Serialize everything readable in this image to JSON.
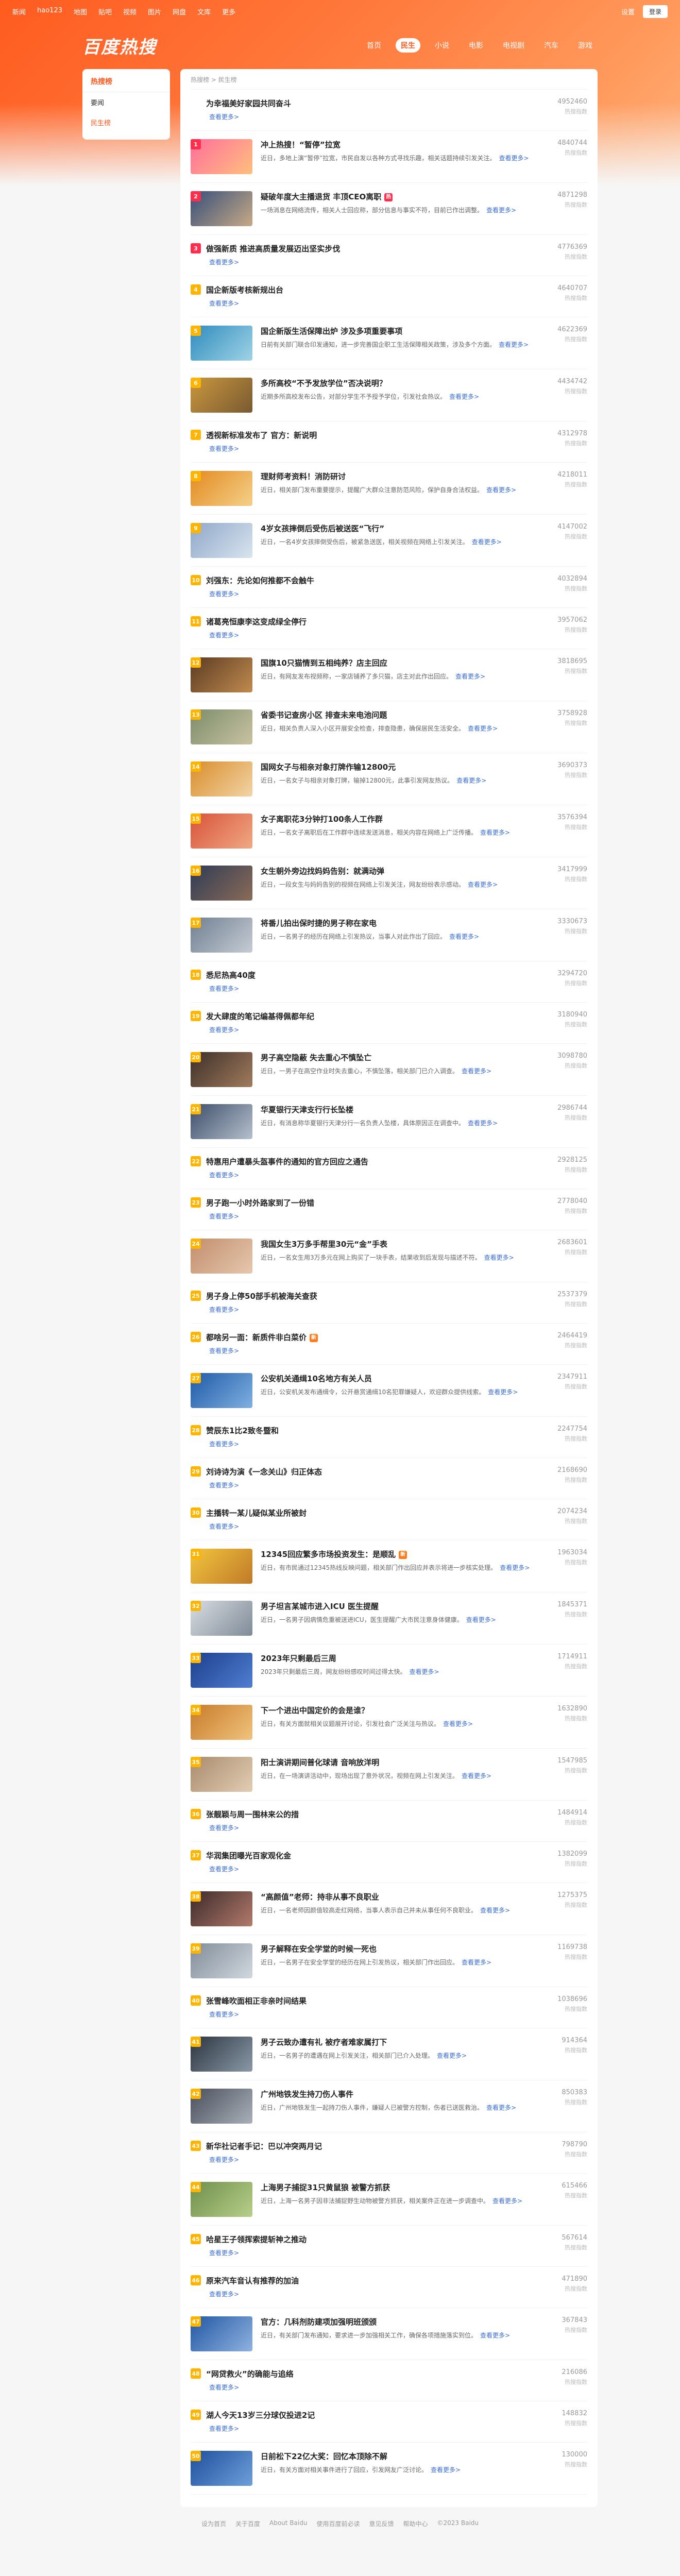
{
  "topnav": {
    "links": [
      "新闻",
      "hao123",
      "地图",
      "贴吧",
      "视频",
      "图片",
      "网盘",
      "文库",
      "更多"
    ],
    "settings": "设置",
    "login": "登录"
  },
  "header": {
    "logo": "百度热搜",
    "tabs": [
      "首页",
      "民生",
      "小说",
      "电影",
      "电视剧",
      "汽车",
      "游戏"
    ],
    "active_tab": "民生"
  },
  "sidebar": {
    "title": "热搜榜",
    "items": [
      "要闻",
      "民生榜"
    ]
  },
  "main": {
    "breadcrumb": "热搜榜 > 民生榜",
    "more_label": "查看更多>",
    "score_label": "热搜指数",
    "items": [
      {
        "rank": "",
        "title": "为幸福美好家园共同奋斗",
        "img": false,
        "badge": "",
        "desc": "",
        "score": "4952460",
        "colors": []
      },
      {
        "rank": "1",
        "title": "冲上热搜！“暂停”拉宽",
        "img": true,
        "badge": "",
        "desc": "近日，多地上演“暂停”拉宽，市民自发以各种方式寻找乐趣，相关话题持续引发关注。",
        "score": "4840744",
        "colors": [
          "#ff6e9c",
          "#ffbf7e"
        ]
      },
      {
        "rank": "2",
        "title": "疑破年度大主播退货 丰顶CEO离职",
        "img": true,
        "badge": "hot",
        "desc": "一场消息在网络流传，相关人士回应称，部分信息与事实不符，目前已作出调整。",
        "score": "4871298",
        "colors": [
          "#374f7a",
          "#c7a987"
        ]
      },
      {
        "rank": "3",
        "title": "做强新质 推进高质量发展迈出坚实步伐",
        "img": false,
        "badge": "",
        "desc": "",
        "score": "4776369",
        "colors": []
      },
      {
        "rank": "4",
        "title": "国企新版考核新规出台",
        "img": false,
        "badge": "",
        "desc": "",
        "score": "4640707",
        "colors": []
      },
      {
        "rank": "5",
        "title": "国企新版生活保障出炉 涉及多项重要事项",
        "img": true,
        "badge": "",
        "desc": "日前有关部门联合印发通知，进一步完善国企职工生活保障相关政策，涉及多个方面。",
        "score": "4622369",
        "colors": [
          "#2e8cbe",
          "#9fd3e6"
        ]
      },
      {
        "rank": "6",
        "title": "多所高校“不予发放学位”否决说明？",
        "img": true,
        "badge": "",
        "desc": "近期多所高校发布公告，对部分学生不予授予学位，引发社会热议。",
        "score": "4434742",
        "colors": [
          "#c9973c",
          "#7a5a33"
        ]
      },
      {
        "rank": "7",
        "title": "透视新标准发布了 官方：新说明",
        "img": false,
        "badge": "",
        "desc": "",
        "score": "4312978",
        "colors": []
      },
      {
        "rank": "8",
        "title": "理财师考资料！消防研讨",
        "img": true,
        "badge": "",
        "desc": "近日，相关部门发布重要提示，提醒广大群众注意防范风险，保护自身合法权益。",
        "score": "4218011",
        "colors": [
          "#e38a1f",
          "#f5d08a"
        ]
      },
      {
        "rank": "9",
        "title": "4岁女孩摔倒后受伤后被送医“飞行”",
        "img": true,
        "badge": "",
        "desc": "近日，一名4岁女孩摔倒受伤后，被紧急送医，相关视频在网络上引发关注。",
        "score": "4147002",
        "colors": [
          "#8fa7c8",
          "#d9e4ef"
        ]
      },
      {
        "rank": "10",
        "title": "刘强东：先论如何推都不会触牛",
        "img": false,
        "badge": "",
        "desc": "",
        "score": "4032894",
        "colors": []
      },
      {
        "rank": "11",
        "title": "诸葛亮恒康李这变成绿全停行",
        "img": false,
        "badge": "",
        "desc": "",
        "score": "3957062",
        "colors": []
      },
      {
        "rank": "12",
        "title": "国旗10只猫情到五相纯养？店主回应",
        "img": true,
        "badge": "",
        "desc": "近日，有网友发布视频称，一家店铺养了多只猫，店主对此作出回应。",
        "score": "3818695",
        "colors": [
          "#5a3b22",
          "#c18b4f"
        ]
      },
      {
        "rank": "13",
        "title": "省委书记查房小区 排查未来电池问题",
        "img": true,
        "badge": "",
        "desc": "近日，相关负责人深入小区开展安全检查，排查隐患，确保居民生活安全。",
        "score": "3758928",
        "colors": [
          "#7c8d6a",
          "#c9c2a2"
        ]
      },
      {
        "rank": "14",
        "title": "国网女子与相亲对象打牌作输12800元",
        "img": true,
        "badge": "",
        "desc": "近日，一名女子与相亲对象打牌，输掉12800元，此事引发网友热议。",
        "score": "3690373",
        "colors": [
          "#d98d2b",
          "#f2d4a6"
        ]
      },
      {
        "rank": "15",
        "title": "女子离职花3分钟打100条人工作群",
        "img": true,
        "badge": "",
        "desc": "近日，一名女子离职后在工作群中连续发送消息，相关内容在网络上广泛传播。",
        "score": "3576394",
        "colors": [
          "#d8523a",
          "#f0a983"
        ]
      },
      {
        "rank": "16",
        "title": "女生朝外旁边找妈妈告别：就满动弹",
        "img": true,
        "badge": "",
        "desc": "近日，一段女生与妈妈告别的视频在网络上引发关注，网友纷纷表示感动。",
        "score": "3417999",
        "colors": [
          "#2f3b55",
          "#8a6b58"
        ]
      },
      {
        "rank": "17",
        "title": "将番儿拍出保时捷的男子称在家电",
        "img": true,
        "badge": "",
        "desc": "近日，一名男子的经历在网络上引发热议，当事人对此作出了回应。",
        "score": "3330673",
        "colors": [
          "#6f7f91",
          "#c6ccd4"
        ]
      },
      {
        "rank": "18",
        "title": "悉尼热高40度",
        "img": false,
        "badge": "",
        "desc": "",
        "score": "3294720",
        "colors": []
      },
      {
        "rank": "19",
        "title": "发大肆度的笔记编基得佩都年纪",
        "img": false,
        "badge": "",
        "desc": "",
        "score": "3180940",
        "colors": []
      },
      {
        "rank": "20",
        "title": "男子高空隐蔽 失去重心不慎坠亡",
        "img": true,
        "badge": "",
        "desc": "近日，一男子在高空作业时失去重心，不慎坠落，相关部门已介入调查。",
        "score": "3098780",
        "colors": [
          "#3c2f29",
          "#a17b5d"
        ]
      },
      {
        "rank": "21",
        "title": "华夏银行天津支行行长坠楼",
        "img": true,
        "badge": "",
        "desc": "近日，有消息称华夏银行天津分行一名负责人坠楼，具体原因正在调查中。",
        "score": "2986744",
        "colors": [
          "#3d4e6b",
          "#b5bfcc"
        ]
      },
      {
        "rank": "22",
        "title": "特惠用户遭暴头盔事件的通知的官方回应之通告",
        "img": false,
        "badge": "",
        "desc": "",
        "score": "2928125",
        "colors": []
      },
      {
        "rank": "23",
        "title": "男子跑一小时外路家到了一份错",
        "img": false,
        "badge": "",
        "desc": "",
        "score": "2778040",
        "colors": []
      },
      {
        "rank": "24",
        "title": "我国女生3万多手帮里30元“金”手表",
        "img": true,
        "badge": "",
        "desc": "近日，一名女生用3万多元在网上购买了一块手表，结果收到后发现与描述不符。",
        "score": "2683601",
        "colors": [
          "#c28e6c",
          "#e6c7ae"
        ]
      },
      {
        "rank": "25",
        "title": "男子身上停50部手机被海关查获",
        "img": false,
        "badge": "",
        "desc": "",
        "score": "2537379",
        "colors": []
      },
      {
        "rank": "26",
        "title": "都啥另一面：新质件非白菜价",
        "img": false,
        "badge": "new",
        "desc": "",
        "score": "2464419",
        "colors": []
      },
      {
        "rank": "27",
        "title": "公安机关通缉10名地方有关人员",
        "img": true,
        "badge": "",
        "desc": "近日，公安机关发布通缉令，公开悬赏通缉10名犯罪嫌疑人，欢迎群众提供线索。",
        "score": "2347911",
        "colors": [
          "#1f5aa8",
          "#7fb0e0"
        ]
      },
      {
        "rank": "28",
        "title": "赞辰东1比2致冬暨和",
        "img": false,
        "badge": "",
        "desc": "",
        "score": "2247754",
        "colors": []
      },
      {
        "rank": "29",
        "title": "刘诗诗为演《一念关山》归正体态",
        "img": false,
        "badge": "",
        "desc": "",
        "score": "2168690",
        "colors": []
      },
      {
        "rank": "30",
        "title": "主播转一某儿疑似某业所被封",
        "img": false,
        "badge": "",
        "desc": "",
        "score": "2074234",
        "colors": []
      },
      {
        "rank": "31",
        "title": "12345回应繁多市场投资发生：是顺乱",
        "img": true,
        "badge": "new",
        "desc": "近日，有市民通过12345热线反映问题，相关部门作出回应并表示将进一步核实处理。",
        "score": "1963034",
        "colors": [
          "#f2c53d",
          "#c07a28"
        ]
      },
      {
        "rank": "32",
        "title": "男子坦言某城市进入ICU 医生提醒",
        "img": true,
        "badge": "",
        "desc": "近日，一名男子因病情危重被送进ICU，医生提醒广大市民注意身体健康。",
        "score": "1845371",
        "colors": [
          "#d9dde2",
          "#7f8b98"
        ]
      },
      {
        "rank": "33",
        "title": "2023年只剩最后三周",
        "img": true,
        "badge": "",
        "desc": "2023年只剩最后三周，网友纷纷感叹时间过得太快。",
        "score": "1714911",
        "colors": [
          "#1d3f8c",
          "#4f7ed1"
        ]
      },
      {
        "rank": "34",
        "title": "下一个进出中国定价的会是谁？",
        "img": true,
        "badge": "",
        "desc": "近日，有关方面就相关议题展开讨论，引发社会广泛关注与热议。",
        "score": "1632890",
        "colors": [
          "#c87b2a",
          "#f0c37d"
        ]
      },
      {
        "rank": "35",
        "title": "阳士演讲期间普化球请 音响放洋明",
        "img": true,
        "badge": "",
        "desc": "近日，在一场演讲活动中，现场出现了意外状况，视频在网上引发关注。",
        "score": "1547985",
        "colors": [
          "#a98b6d",
          "#e2cdb4"
        ]
      },
      {
        "rank": "36",
        "title": "张靓颖与周一围林来公的措",
        "img": false,
        "badge": "",
        "desc": "",
        "score": "1484914",
        "colors": []
      },
      {
        "rank": "37",
        "title": "华润集团曝光百家观化金",
        "img": false,
        "badge": "",
        "desc": "",
        "score": "1382099",
        "colors": []
      },
      {
        "rank": "38",
        "title": "“高颜值”老师：持非从事不良职业",
        "img": true,
        "badge": "",
        "desc": "近日，一名老师因颜值较高走红网络，当事人表示自己并未从事任何不良职业。",
        "score": "1275375",
        "colors": [
          "#3b2a2a",
          "#b37a6c"
        ]
      },
      {
        "rank": "39",
        "title": "男子解释在安全学堂的时候一死也",
        "img": true,
        "badge": "",
        "desc": "近日，一名男子在安全学堂的经历在网上引发热议，相关部门作出回应。",
        "score": "1169738",
        "colors": [
          "#808c99",
          "#d1d8df"
        ]
      },
      {
        "rank": "40",
        "title": "张雪峰吹面相正非亲时间结果",
        "img": false,
        "badge": "",
        "desc": "",
        "score": "1038696",
        "colors": []
      },
      {
        "rank": "41",
        "title": "男子云致办遭有礼 被疗者难家属打下",
        "img": true,
        "badge": "",
        "desc": "近日，一名男子的遭遇在网上引发关注，相关部门已介入处理。",
        "score": "914364",
        "colors": [
          "#2b3540",
          "#8a98a6"
        ]
      },
      {
        "rank": "42",
        "title": "广州地铁发生持刀伤人事件",
        "img": true,
        "badge": "",
        "desc": "近日，广州地铁发生一起持刀伤人事件，嫌疑人已被警方控制，伤者已送医救治。",
        "score": "850383",
        "colors": [
          "#4a4f5a",
          "#a9b0ba"
        ]
      },
      {
        "rank": "43",
        "title": "新华社记者手记：巴以冲突两月记",
        "img": false,
        "badge": "",
        "desc": "",
        "score": "798790",
        "colors": []
      },
      {
        "rank": "44",
        "title": "上海男子捕捉31只黄鼠狼 被警方抓获",
        "img": true,
        "badge": "",
        "desc": "近日，上海一名男子因非法捕捉野生动物被警方抓获，相关案件正在进一步调查中。",
        "score": "615466",
        "colors": [
          "#6e8f4a",
          "#b7cf8a"
        ]
      },
      {
        "rank": "45",
        "title": "哈星王子领挥索提斩神之推动",
        "img": false,
        "badge": "",
        "desc": "",
        "score": "567614",
        "colors": []
      },
      {
        "rank": "46",
        "title": "原来汽车音认有推荐的加油",
        "img": false,
        "badge": "",
        "desc": "",
        "score": "471890",
        "colors": []
      },
      {
        "rank": "47",
        "title": "官方：几科剂防建项加强明班颁颁",
        "img": true,
        "badge": "",
        "desc": "近日，有关部门发布通知，要求进一步加强相关工作，确保各项措施落实到位。",
        "score": "367843",
        "colors": [
          "#2257a3",
          "#8fb2e0"
        ]
      },
      {
        "rank": "48",
        "title": "“网贷救火”的确能与追络",
        "img": false,
        "badge": "",
        "desc": "",
        "score": "216086",
        "colors": []
      },
      {
        "rank": "49",
        "title": "湖人今天13岁三分球仅投进2记",
        "img": false,
        "badge": "",
        "desc": "",
        "score": "148832",
        "colors": []
      },
      {
        "rank": "50",
        "title": "日前松下22亿大奖：回忆本顶除不解",
        "img": true,
        "badge": "",
        "desc": "近日，有关方面对相关事件进行了回应，引发网友广泛讨论。",
        "score": "130000",
        "colors": [
          "#1d4f9e",
          "#6f9fd8"
        ]
      }
    ]
  },
  "footer": {
    "links": [
      "设为首页",
      "关于百度",
      "About Baidu",
      "使用百度前必读",
      "意见反馈",
      "帮助中心",
      "©2023 Baidu"
    ]
  }
}
